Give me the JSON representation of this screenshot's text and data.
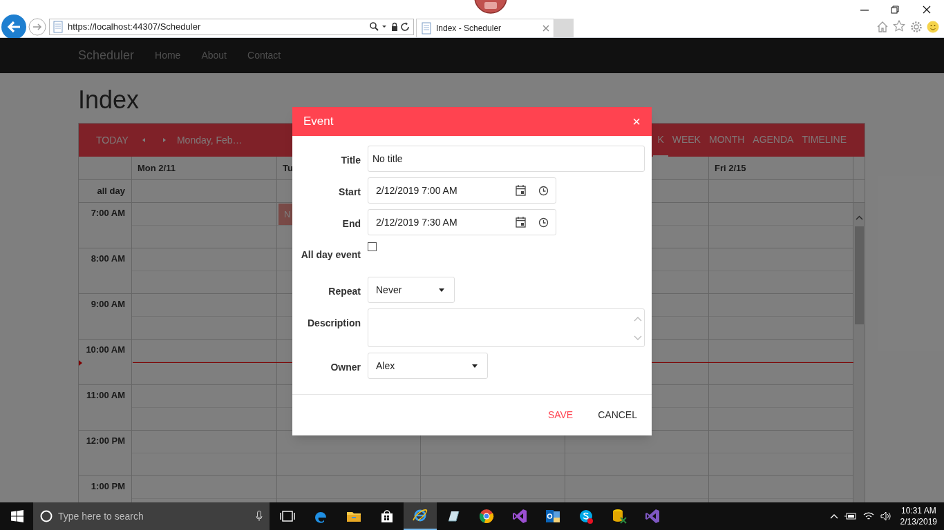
{
  "browser": {
    "address": "https://localhost:44307/Scheduler",
    "tab_title": "Index - Scheduler"
  },
  "navbar": {
    "brand": "Scheduler",
    "links": [
      "Home",
      "About",
      "Contact"
    ]
  },
  "page_title": "Index",
  "scheduler": {
    "toolbar": {
      "today": "TODAY",
      "date_label": "Monday, Feb…",
      "views": [
        {
          "label": "K",
          "selected": true
        },
        {
          "label": "WEEK",
          "selected": false
        },
        {
          "label": "MONTH",
          "selected": false
        },
        {
          "label": "AGENDA",
          "selected": false
        },
        {
          "label": "TIMELINE",
          "selected": false
        }
      ]
    },
    "all_day_label": "all day",
    "days": [
      {
        "kind": "day",
        "label": "Mon 2/11"
      },
      {
        "kind": "day",
        "label": "Tu",
        "events": [
          {
            "title": "N"
          }
        ]
      },
      {
        "kind": "covered"
      },
      {
        "kind": "covered"
      },
      {
        "kind": "day",
        "label": "Fri 2/15"
      }
    ],
    "slots": [
      "7:00 AM",
      "8:00 AM",
      "9:00 AM",
      "10:00 AM",
      "11:00 AM",
      "12:00 PM",
      "1:00 PM"
    ]
  },
  "dialog": {
    "title": "Event",
    "close": "×",
    "fields": [
      {
        "kind": "text",
        "label": "Title",
        "value": "No title"
      },
      {
        "kind": "datetime",
        "label": "Start",
        "value": "2/12/2019 7:00 AM"
      },
      {
        "kind": "datetime",
        "label": "End",
        "value": "2/12/2019 7:30 AM"
      },
      {
        "kind": "checkbox",
        "label": "All day event",
        "checked": false
      },
      {
        "kind": "select",
        "label": "Repeat",
        "value": "Never"
      },
      {
        "kind": "textarea",
        "label": "Description"
      },
      {
        "kind": "select_wide",
        "label": "Owner",
        "value": "Alex"
      }
    ],
    "buttons": [
      {
        "label": "SAVE",
        "kind": "primary"
      },
      {
        "label": "CANCEL",
        "kind": "plain"
      }
    ]
  },
  "taskbar": {
    "search_placeholder": "Type here to search",
    "apps": [
      {
        "kind": "taskview",
        "selected": false
      },
      {
        "kind": "edge",
        "selected": false
      },
      {
        "kind": "folder",
        "selected": false
      },
      {
        "kind": "store",
        "selected": false
      },
      {
        "kind": "ie",
        "selected": true
      },
      {
        "kind": "notes",
        "selected": false
      },
      {
        "kind": "chrome",
        "selected": false
      },
      {
        "kind": "vs",
        "selected": false
      },
      {
        "kind": "outlook",
        "selected": false
      },
      {
        "kind": "skype",
        "selected": false
      },
      {
        "kind": "db",
        "selected": false
      },
      {
        "kind": "vs2",
        "selected": false
      }
    ],
    "time": "10:31 AM",
    "date": "2/13/2019"
  }
}
